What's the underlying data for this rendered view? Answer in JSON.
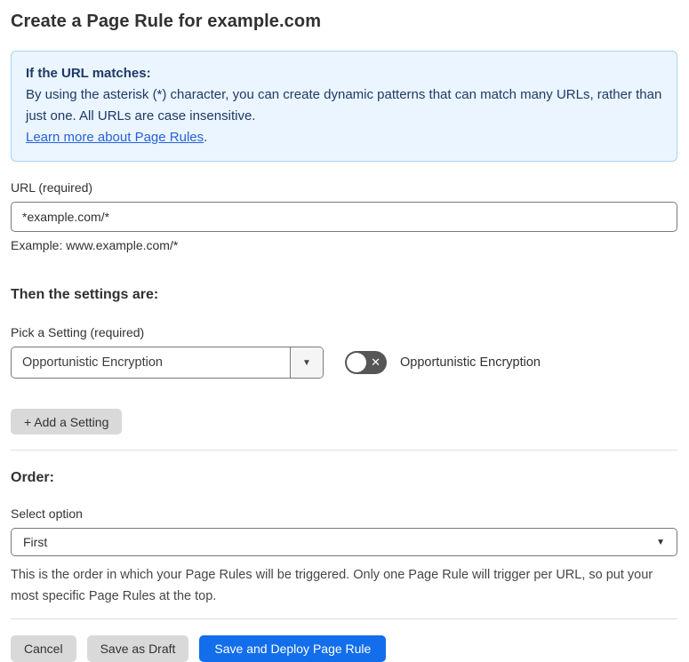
{
  "page": {
    "title": "Create a Page Rule for example.com"
  },
  "info_box": {
    "heading": "If the URL matches:",
    "body": "By using the asterisk (*) character, you can create dynamic patterns that can match many URLs, rather than just one. All URLs are case insensitive.",
    "link_text": "Learn more about Page Rules",
    "link_suffix": "."
  },
  "url_section": {
    "label": "URL (required)",
    "value": "*example.com/*",
    "example": "Example: www.example.com/*"
  },
  "settings_section": {
    "heading": "Then the settings are:",
    "pick_label": "Pick a Setting (required)",
    "selected_setting": "Opportunistic Encryption",
    "toggle_label": "Opportunistic Encryption",
    "toggle_state": "off",
    "add_button_label": "+ Add a Setting"
  },
  "order_section": {
    "heading": "Order:",
    "label": "Select option",
    "selected_option": "First",
    "help": "This is the order in which your Page Rules will be triggered. Only one Page Rule will trigger per URL, so put your most specific Page Rules at the top."
  },
  "footer": {
    "cancel_label": "Cancel",
    "save_draft_label": "Save as Draft",
    "save_deploy_label": "Save and Deploy Page Rule"
  },
  "icons": {
    "dropdown_arrow": "▼",
    "toggle_off_x": "✕"
  },
  "colors": {
    "accent_blue": "#126EEB",
    "info_background": "#EBF5FF",
    "info_border": "#AAD2F7",
    "info_text": "#1E3A66",
    "link_blue": "#2762D9",
    "body_text": "#313131",
    "button_gray": "#D9D9D9",
    "toggle_off_gray": "#565656"
  }
}
